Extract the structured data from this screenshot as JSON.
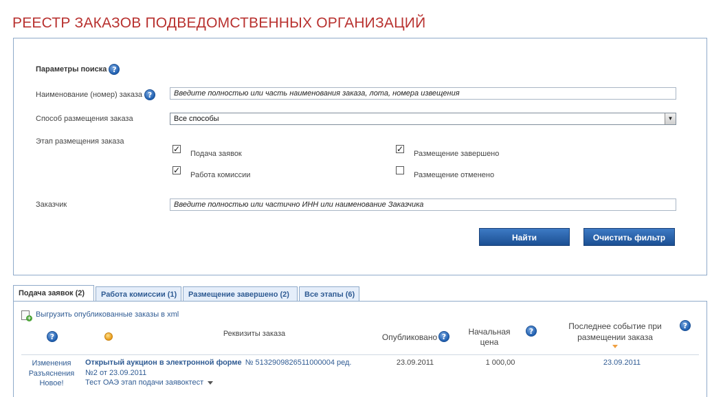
{
  "page": {
    "title": "РЕЕСТР ЗАКАЗОВ ПОДВЕДОМСТВЕННЫХ ОРГАНИЗАЦИЙ"
  },
  "filter": {
    "section_title": "Параметры поиска",
    "name_label": "Наименование (номер) заказа",
    "name_placeholder": "Введите полностью или часть наименования заказа, лота, номера извещения",
    "method_label": "Способ размещения заказа",
    "method_selected": "Все способы",
    "stage_label": "Этап размещения заказа",
    "stages": [
      {
        "label": "Подача заявок",
        "checked": true
      },
      {
        "label": "Работа комиссии",
        "checked": true
      },
      {
        "label": "Размещение завершено",
        "checked": true
      },
      {
        "label": "Размещение отменено",
        "checked": false
      }
    ],
    "customer_label": "Заказчик",
    "customer_placeholder": "Введите полностью или частично ИНН или наименование Заказчика",
    "find_button": "Найти",
    "clear_button": "Очистить фильтр"
  },
  "tabs": [
    {
      "label": "Подача заявок (2)",
      "active": true
    },
    {
      "label": "Работа комиссии (1)",
      "active": false
    },
    {
      "label": "Размещение завершено (2)",
      "active": false
    },
    {
      "label": "Все этапы (6)",
      "active": false
    }
  ],
  "results": {
    "export_link": "Выгрузить опубликованные заказы в xml",
    "columns": {
      "requisites": "Реквизиты заказа",
      "published": "Опубликовано",
      "price_line1": "Начальная",
      "price_line2": "цена",
      "event_line1": "Последнее событие при",
      "event_line2": "размещении заказа"
    },
    "rows": [
      {
        "status_changes": "Изменения",
        "status_clarifications": "Разъяснения",
        "status_new": "Новое!",
        "type": "Открытый аукцион в электронной форме",
        "number": "№  5132909826511000004 ред.",
        "revision": "№2 от 23.09.2011",
        "subject": "Тест ОАЭ этап подачи заявоктест",
        "published": "23.09.2011",
        "price": "1 000,00",
        "last_event": "23.09.2011"
      }
    ]
  },
  "colors": {
    "title": "#b8312f",
    "link": "#2f5b93",
    "button": "#1b4f93",
    "border": "#8ea9c9"
  }
}
